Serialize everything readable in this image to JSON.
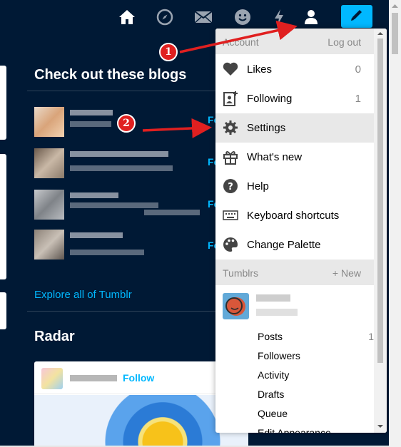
{
  "topnav": {
    "icons": [
      "home-icon",
      "explore-icon",
      "inbox-icon",
      "messaging-icon",
      "activity-icon",
      "account-icon",
      "compose-icon"
    ],
    "compose_color": "#00b8ff"
  },
  "blogs": {
    "title": "Check out these blogs",
    "follow_label": "Follow",
    "explore_label": "Explore all of Tumblr"
  },
  "radar": {
    "title": "Radar",
    "follow_label": "Follow"
  },
  "menu": {
    "account_header": "Account",
    "logout": "Log out",
    "items": [
      {
        "label": "Likes",
        "count": "0",
        "icon": "heart-icon"
      },
      {
        "label": "Following",
        "count": "1",
        "icon": "following-icon"
      },
      {
        "label": "Settings",
        "count": "",
        "icon": "gear-icon"
      },
      {
        "label": "What's new",
        "count": "",
        "icon": "gift-icon"
      },
      {
        "label": "Help",
        "count": "",
        "icon": "help-icon"
      },
      {
        "label": "Keyboard shortcuts",
        "count": "",
        "icon": "keyboard-icon"
      },
      {
        "label": "Change Palette",
        "count": "",
        "icon": "palette-icon"
      }
    ],
    "tumblrs_header": "Tumblrs",
    "new_label": "+ New",
    "sub_items": [
      {
        "label": "Posts",
        "count": "1"
      },
      {
        "label": "Followers",
        "count": ""
      },
      {
        "label": "Activity",
        "count": ""
      },
      {
        "label": "Drafts",
        "count": ""
      },
      {
        "label": "Queue",
        "count": ""
      },
      {
        "label": "Edit Appearance",
        "count": ""
      }
    ]
  },
  "annotations": {
    "step1": "1",
    "step2": "2",
    "color": "#e02020"
  }
}
